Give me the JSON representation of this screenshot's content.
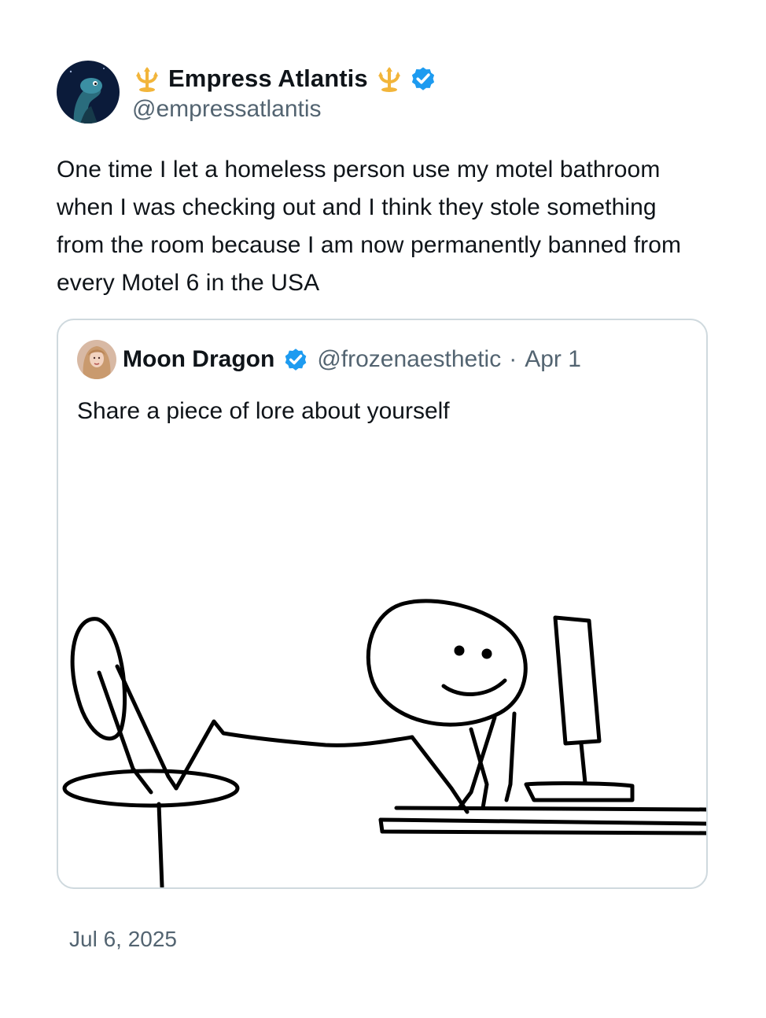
{
  "tweet": {
    "display_name": "Empress Atlantis",
    "handle": "@empressatlantis",
    "text": "One time I let a homeless person use my motel bathroom when I was checking out and I think they stole something from the room because I am now permanently banned from every Motel 6 in the USA",
    "name_emoji": "trident-emblem-icon",
    "verified_color": "#1d9bf0",
    "date": "Jul 6, 2025"
  },
  "quote": {
    "display_name": "Moon Dragon",
    "handle": "@frozenaesthetic",
    "separator": "·",
    "date": "Apr 1",
    "text": "Share a piece of lore about yourself",
    "image_icon": "stick-figure-drawing"
  }
}
